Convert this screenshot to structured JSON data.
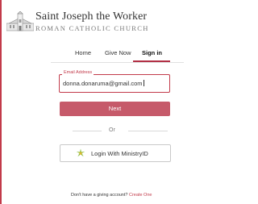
{
  "header": {
    "church_name": "Saint Joseph the Worker",
    "church_subtitle": "ROMAN CATHOLIC CHURCH",
    "logo_icon": "church-building-icon"
  },
  "nav": {
    "items": [
      {
        "label": "Home"
      },
      {
        "label": "Give Now"
      },
      {
        "label": "Sign in",
        "active": true
      }
    ]
  },
  "form": {
    "email_label": "Email Address",
    "email_value": "donna.donaruma@gmail.com",
    "next_label": "Next",
    "or_label": "Or",
    "ministry_label": "Login With MinistryID",
    "ministry_icon": "ministryid-star-icon"
  },
  "footer": {
    "prompt": "Don't have a giving account? ",
    "link": "Create One"
  },
  "colors": {
    "accent": "#c23a4a",
    "button": "#c65a6a",
    "ministry_green": "#7ab83a",
    "ministry_yellow": "#e3b92b"
  }
}
